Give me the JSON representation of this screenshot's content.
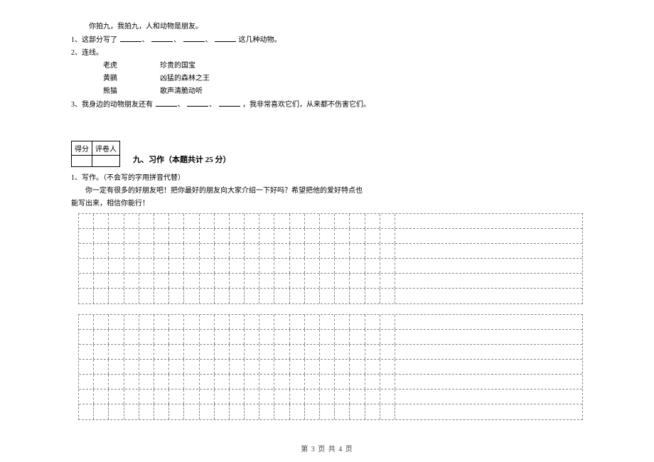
{
  "top": {
    "l1": "你拍九，我拍九，人和动物是朋友。",
    "q1_prefix": "1、这部分写了",
    "q1_suffix": "这几种动物。",
    "q2": "2、连线。",
    "pairs": [
      {
        "left": "老虎",
        "right": "珍贵的国宝"
      },
      {
        "left": "黄鹂",
        "right": "凶猛的森林之王"
      },
      {
        "left": "熊猫",
        "right": "歌声清脆动听"
      }
    ],
    "q3_prefix": "3、我身边的动物朋友还有",
    "q3_suffix": "，我非常喜欢它们，从来都不伤害它们。"
  },
  "score": {
    "h1": "得分",
    "h2": "评卷人"
  },
  "section": {
    "title": "九、习作（本题共计 25 分）"
  },
  "writing": {
    "q": "1、写作。（不会写的字用拼音代替）",
    "body_a": "你一定有很多的好朋友吧！把你最好的朋友向大家介绍一下好吗？希望把他的爱好特点也",
    "body_b": "能写出来，相信你能行！"
  },
  "pager": "第 3 页 共 4 页",
  "sep": "、"
}
